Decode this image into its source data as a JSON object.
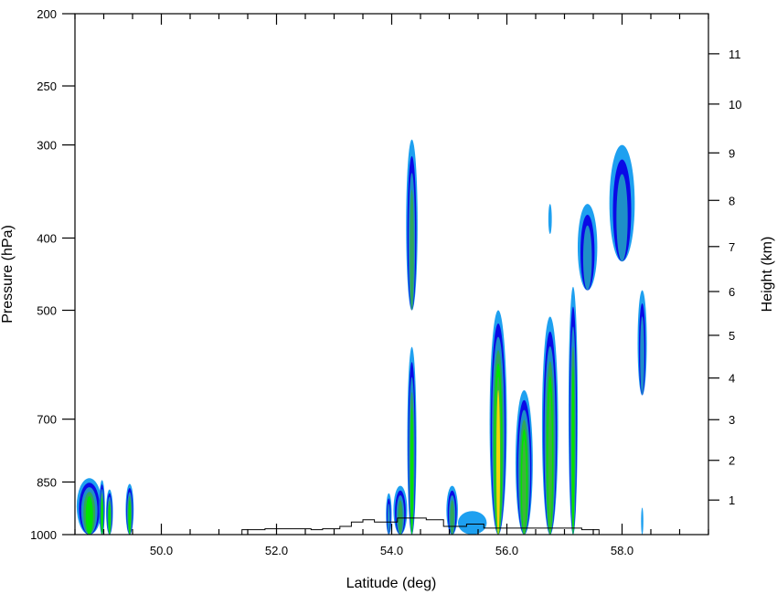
{
  "chart_data": {
    "type": "contour",
    "title": "",
    "xlabel": "Latitude (deg)",
    "ylabel_left": "Pressure (hPa)",
    "ylabel_right": "Height (km)",
    "xlim": [
      48.5,
      59.5
    ],
    "ylim_pressure": [
      1000,
      200
    ],
    "y_scale": "log",
    "x_ticks": [
      {
        "value": 50.0,
        "label": "50.0"
      },
      {
        "value": 52.0,
        "label": "52.0"
      },
      {
        "value": 54.0,
        "label": "54.0"
      },
      {
        "value": 56.0,
        "label": "56.0"
      },
      {
        "value": 58.0,
        "label": "58.0"
      }
    ],
    "x_minor_step": 0.5,
    "pressure_ticks": [
      {
        "value": 1000,
        "label": "1000"
      },
      {
        "value": 850,
        "label": "850"
      },
      {
        "value": 700,
        "label": "700"
      },
      {
        "value": 500,
        "label": "500"
      },
      {
        "value": 400,
        "label": "400"
      },
      {
        "value": 300,
        "label": "300"
      },
      {
        "value": 250,
        "label": "250"
      },
      {
        "value": 200,
        "label": "200"
      }
    ],
    "height_ticks": [
      {
        "km": 1,
        "label": "1"
      },
      {
        "km": 2,
        "label": "2"
      },
      {
        "km": 3,
        "label": "3"
      },
      {
        "km": 4,
        "label": "4"
      },
      {
        "km": 5,
        "label": "5"
      },
      {
        "km": 6,
        "label": "6"
      },
      {
        "km": 7,
        "label": "7"
      },
      {
        "km": 8,
        "label": "8"
      },
      {
        "km": 9,
        "label": "9"
      },
      {
        "km": 10,
        "label": "10"
      },
      {
        "km": 11,
        "label": "11"
      }
    ],
    "levels": [
      {
        "level": 1,
        "color": "#1ea0f0"
      },
      {
        "level": 2,
        "color": "#0a0ae6"
      },
      {
        "level": 3,
        "color": "#1e8fc8"
      },
      {
        "level": 4,
        "color": "#2fa75a"
      },
      {
        "level": 5,
        "color": "#00e400"
      },
      {
        "level": 6,
        "color": "#3cb43c"
      },
      {
        "level": 7,
        "color": "#f5d60a"
      }
    ],
    "cells": [
      {
        "lat": 48.75,
        "lon_halfwidth": 0.22,
        "p_top": 840,
        "p_bottom": 1000,
        "max_level": 5
      },
      {
        "lat": 48.97,
        "lon_halfwidth": 0.05,
        "p_top": 845,
        "p_bottom": 1000,
        "max_level": 5
      },
      {
        "lat": 49.1,
        "lon_halfwidth": 0.06,
        "p_top": 870,
        "p_bottom": 1000,
        "max_level": 5
      },
      {
        "lat": 49.45,
        "lon_halfwidth": 0.07,
        "p_top": 855,
        "p_bottom": 1000,
        "max_level": 5
      },
      {
        "lat": 53.95,
        "lon_halfwidth": 0.05,
        "p_top": 880,
        "p_bottom": 1000,
        "max_level": 3
      },
      {
        "lat": 54.15,
        "lon_halfwidth": 0.12,
        "p_top": 860,
        "p_bottom": 1000,
        "max_level": 4
      },
      {
        "lat": 54.35,
        "lon_halfwidth": 0.1,
        "p_top": 295,
        "p_bottom": 500,
        "max_level": 4
      },
      {
        "lat": 54.35,
        "lon_halfwidth": 0.08,
        "p_top": 560,
        "p_bottom": 1000,
        "max_level": 5
      },
      {
        "lat": 55.05,
        "lon_halfwidth": 0.1,
        "p_top": 860,
        "p_bottom": 1000,
        "max_level": 4
      },
      {
        "lat": 55.4,
        "lon_halfwidth": 0.25,
        "p_top": 930,
        "p_bottom": 1000,
        "max_level": 1
      },
      {
        "lat": 55.85,
        "lon_halfwidth": 0.15,
        "p_top": 500,
        "p_bottom": 1000,
        "max_level": 7
      },
      {
        "lat": 56.3,
        "lon_halfwidth": 0.15,
        "p_top": 640,
        "p_bottom": 1000,
        "max_level": 6
      },
      {
        "lat": 56.75,
        "lon_halfwidth": 0.14,
        "p_top": 510,
        "p_bottom": 1000,
        "max_level": 6
      },
      {
        "lat": 57.15,
        "lon_halfwidth": 0.08,
        "p_top": 465,
        "p_bottom": 1000,
        "max_level": 5
      },
      {
        "lat": 56.75,
        "lon_halfwidth": 0.03,
        "p_top": 360,
        "p_bottom": 395,
        "max_level": 1
      },
      {
        "lat": 57.4,
        "lon_halfwidth": 0.17,
        "p_top": 360,
        "p_bottom": 470,
        "max_level": 3
      },
      {
        "lat": 58.0,
        "lon_halfwidth": 0.22,
        "p_top": 300,
        "p_bottom": 430,
        "max_level": 3
      },
      {
        "lat": 58.35,
        "lon_halfwidth": 0.08,
        "p_top": 470,
        "p_bottom": 650,
        "max_level": 3
      },
      {
        "lat": 58.35,
        "lon_halfwidth": 0.02,
        "p_top": 920,
        "p_bottom": 1000,
        "max_level": 1
      }
    ],
    "terrain_outline": [
      {
        "lat": 51.4,
        "p": 985
      },
      {
        "lat": 51.5,
        "p": 985
      },
      {
        "lat": 51.8,
        "p": 982
      },
      {
        "lat": 52.1,
        "p": 982
      },
      {
        "lat": 52.6,
        "p": 985
      },
      {
        "lat": 52.8,
        "p": 982
      },
      {
        "lat": 53.1,
        "p": 975
      },
      {
        "lat": 53.3,
        "p": 962
      },
      {
        "lat": 53.5,
        "p": 955
      },
      {
        "lat": 53.7,
        "p": 962
      },
      {
        "lat": 54.1,
        "p": 950
      },
      {
        "lat": 54.6,
        "p": 955
      },
      {
        "lat": 54.9,
        "p": 975
      },
      {
        "lat": 55.3,
        "p": 968
      },
      {
        "lat": 55.6,
        "p": 980
      },
      {
        "lat": 57.3,
        "p": 985
      },
      {
        "lat": 57.6,
        "p": 985
      }
    ],
    "grid": false,
    "legend": "none"
  }
}
